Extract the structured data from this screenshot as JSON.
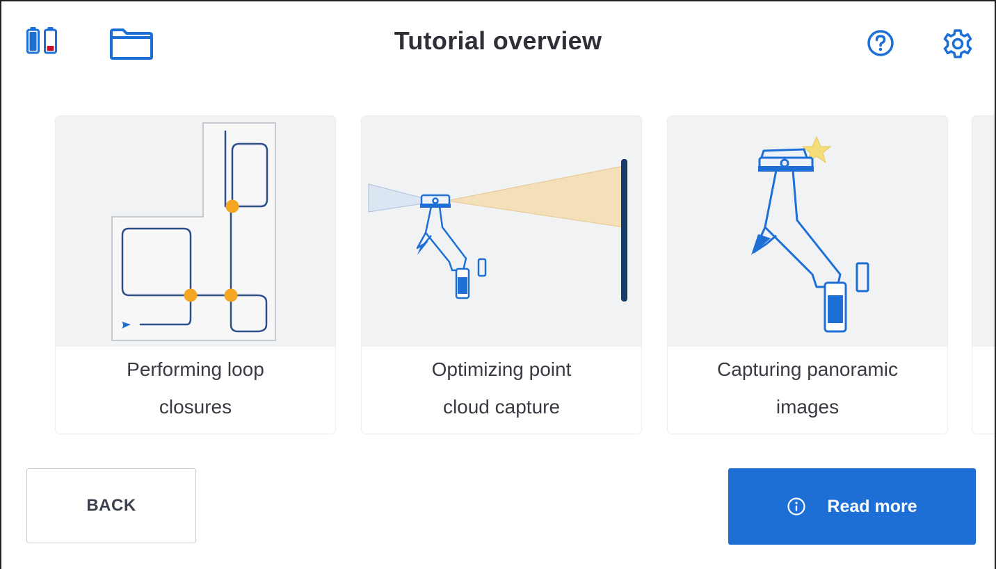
{
  "header": {
    "title": "Tutorial overview"
  },
  "icons": {
    "battery_1": "battery-full-icon",
    "battery_2": "battery-low-icon",
    "folder": "folder-icon",
    "help": "help-icon",
    "settings": "gear-icon",
    "info": "info-icon"
  },
  "cards": [
    {
      "line1": "Performing loop",
      "line2": "closures"
    },
    {
      "line1": "Optimizing point",
      "line2": "cloud capture"
    },
    {
      "line1": "Capturing panoramic",
      "line2": "images"
    }
  ],
  "buttons": {
    "back_label": "BACK",
    "read_more_label": "Read more"
  },
  "colors": {
    "accent": "#1d6fd6",
    "battery_low": "#c8102e",
    "marker": "#f5a623",
    "card_image_bg": "#f1f2f4"
  }
}
